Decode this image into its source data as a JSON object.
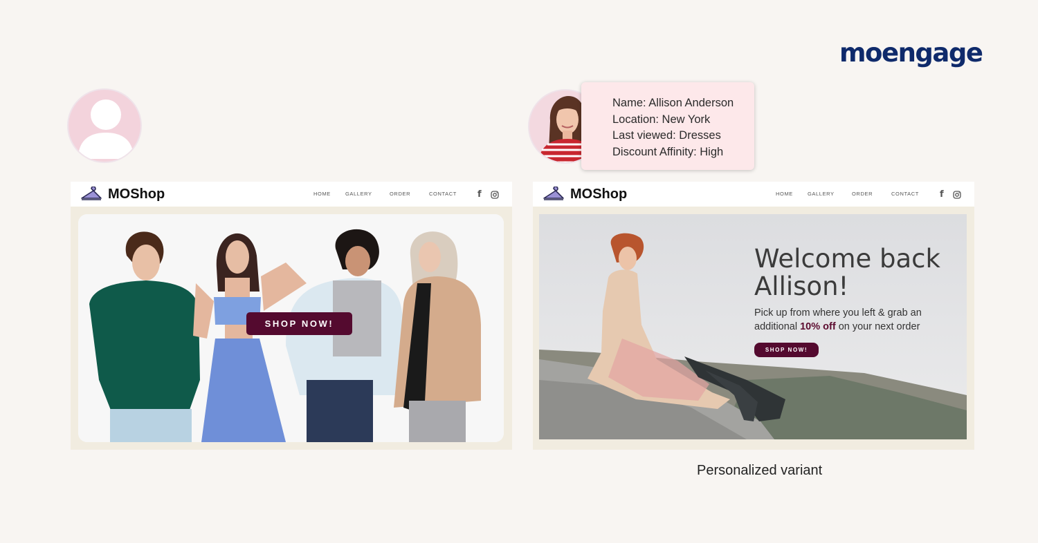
{
  "brand": {
    "logo_text": "moengage",
    "color": "#0f2a6b"
  },
  "profile_card": {
    "lines": [
      "Name: Allison Anderson",
      "Location: New York",
      "Last viewed: Dresses",
      "Discount Affinity: High"
    ]
  },
  "site": {
    "logo_icon": "hanger-icon",
    "logo_text": "MOShop",
    "nav": [
      "HOME",
      "GALLERY",
      "ORDER",
      "CONTACT"
    ],
    "social_icons": [
      "facebook-icon",
      "instagram-icon"
    ],
    "social_facebook_glyph": "f"
  },
  "default_variant": {
    "cta": "SHOP NOW!"
  },
  "personalized_variant": {
    "title": "Welcome back Allison!",
    "subtitle_before": "Pick up from where you left & grab an additional ",
    "subtitle_bold": "10% off",
    "subtitle_after": " on your next order",
    "cta": "SHOP NOW!",
    "caption": "Personalized variant"
  },
  "colors": {
    "cta": "#540a2f",
    "avatar_bg": "#f3d3dc",
    "card_bg": "#fde8ea",
    "page_bg": "#f8f5f2",
    "site_frame": "#f1ece0"
  }
}
